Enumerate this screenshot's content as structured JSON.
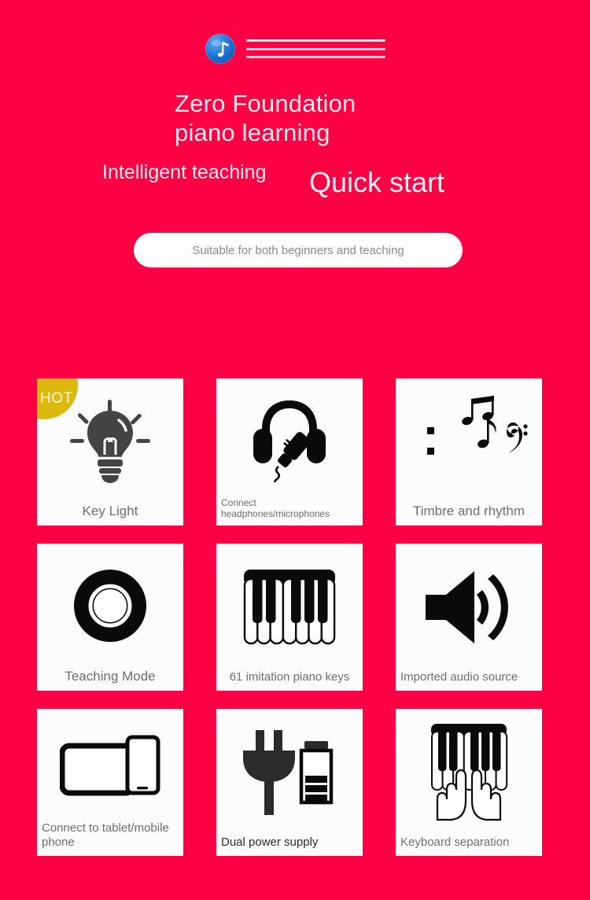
{
  "page": {
    "background_color": "#fc0245",
    "card_background": "#fcfcfc",
    "label_color": "#6e6e6e",
    "badge_color": "#ddb80e"
  },
  "hero": {
    "brand_icon": "music-note-circle-icon",
    "staff_lines": 3,
    "headline": "Zero Foundation piano learning",
    "subtitle_left": "Intelligent teaching",
    "subtitle_right": "Quick start",
    "pill_text": "Suitable for both beginners and teaching"
  },
  "features": {
    "badge": "HOT",
    "cards": [
      {
        "label": "Key Light",
        "icon": "lightbulb-icon",
        "badge": true
      },
      {
        "label": "Connect headphones/microphones",
        "icon": "headphones-mic-icon",
        "badge": false
      },
      {
        "label": "Timbre and rhythm",
        "icon": "music-notes-icon",
        "badge": false
      },
      {
        "label": "Teaching Mode",
        "icon": "ring-donut-icon",
        "badge": false
      },
      {
        "label": "61 imitation piano keys",
        "icon": "piano-keys-icon",
        "badge": false
      },
      {
        "label": "Imported audio source",
        "icon": "speaker-waves-icon",
        "badge": false
      },
      {
        "label": "Connect to tablet/mobile phone",
        "icon": "tablet-phone-icon",
        "badge": false
      },
      {
        "label": "Dual power supply",
        "icon": "plug-battery-icon",
        "badge": false
      },
      {
        "label": "Keyboard separation",
        "icon": "keys-hands-icon",
        "badge": false
      }
    ]
  }
}
